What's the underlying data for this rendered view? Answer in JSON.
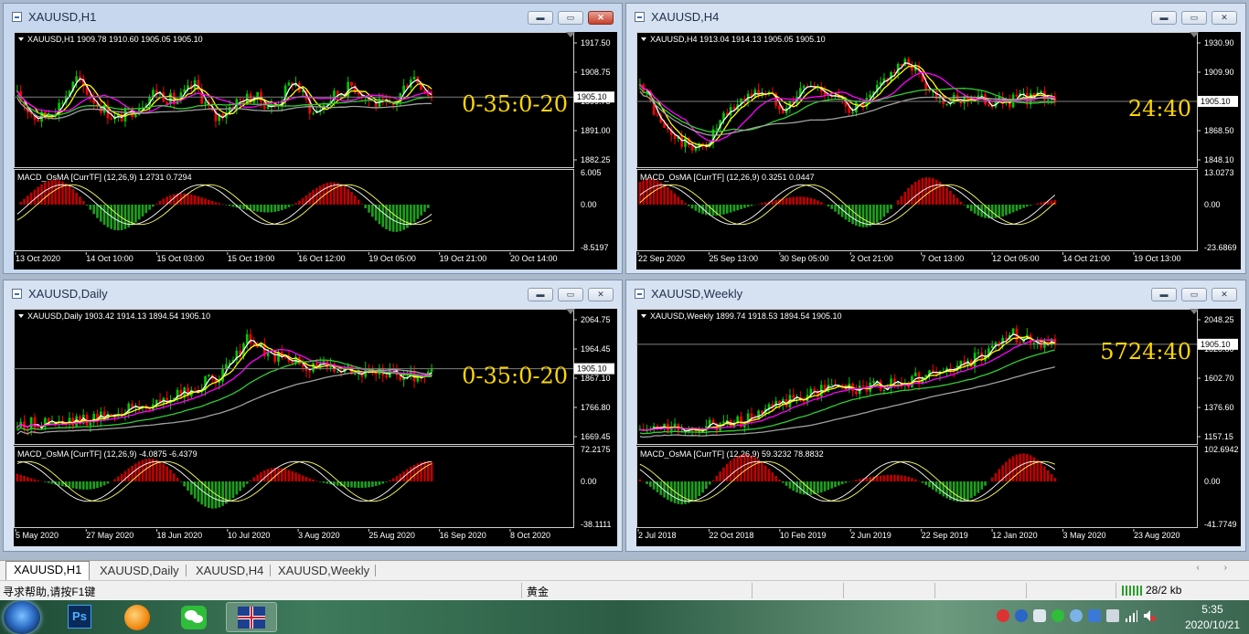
{
  "windows": [
    {
      "title": "XAUUSD,H1",
      "active": true,
      "info": "XAUUSD,H1  1909.78 1910.60 1905.05 1905.10",
      "overlay_text": "0-35:0-20",
      "price_ticks": [
        "1917.50",
        "1908.75",
        "1899.75",
        "1891.00",
        "1882.25"
      ],
      "current_price": "1905.10",
      "indicator_info": "MACD_OsMA [CurrTF] (12,26,9) 1.2731 0.7294",
      "ind_ticks": [
        "6.005",
        "0.00",
        "-8.5197"
      ],
      "dates": [
        "13 Oct 2020",
        "14 Oct 10:00",
        "15 Oct 03:00",
        "15 Oct 19:00",
        "16 Oct 12:00",
        "19 Oct 05:00",
        "19 Oct 21:00",
        "20 Oct 14:00"
      ]
    },
    {
      "title": "XAUUSD,H4",
      "active": false,
      "info": "XAUUSD,H4  1913.04 1914.13 1905.05 1905.10",
      "overlay_text": "24:40",
      "price_ticks": [
        "1930.90",
        "1909.90",
        "1889.55",
        "1868.50",
        "1848.10"
      ],
      "current_price": "1905.10",
      "indicator_info": "MACD_OsMA [CurrTF] (12,26,9) 0.3251 0.0447",
      "ind_ticks": [
        "13.0273",
        "0.00",
        "-23.6869"
      ],
      "dates": [
        "22 Sep 2020",
        "25 Sep 13:00",
        "30 Sep 05:00",
        "2 Oct 21:00",
        "7 Oct 13:00",
        "12 Oct 05:00",
        "14 Oct 21:00",
        "19 Oct 13:00"
      ]
    },
    {
      "title": "XAUUSD,Daily",
      "active": false,
      "info": "XAUUSD,Daily  1903.42 1914.13 1894.54 1905.10",
      "overlay_text": "0-35:0-20",
      "price_ticks": [
        "2064.75",
        "1964.45",
        "1867.10",
        "1766.80",
        "1669.45"
      ],
      "current_price": "1905.10",
      "indicator_info": "MACD_OsMA [CurrTF] (12,26,9) -4.0875 -6.4379",
      "ind_ticks": [
        "72.2175",
        "0.00",
        "-38.1111"
      ],
      "dates": [
        "5 May 2020",
        "27 May 2020",
        "18 Jun 2020",
        "10 Jul 2020",
        "3 Aug 2020",
        "25 Aug 2020",
        "16 Sep 2020",
        "8 Oct 2020"
      ]
    },
    {
      "title": "XAUUSD,Weekly",
      "active": false,
      "info": "XAUUSD,Weekly  1899.74 1918.53 1894.54 1905.10",
      "overlay_text": "5724:40",
      "price_ticks": [
        "2048.25",
        "1828.80",
        "1602.70",
        "1376.60",
        "1157.15"
      ],
      "current_price": "1905.10",
      "indicator_info": "MACD_OsMA [CurrTF] (12,26,9) 59.3232 78.8832",
      "ind_ticks": [
        "102.6942",
        "0.00",
        "-41.7749"
      ],
      "dates": [
        "2 Jul 2018",
        "22 Oct 2018",
        "10 Feb 2019",
        "2 Jun 2019",
        "22 Sep 2019",
        "12 Jan 2020",
        "3 May 2020",
        "23 Aug 2020"
      ]
    }
  ],
  "window_buttons": {
    "minimize": "▬",
    "maximize": "▭",
    "close": "✕"
  },
  "tabs": [
    "XAUUSD,H1",
    "XAUUSD,Daily",
    "XAUUSD,H4",
    "XAUUSD,Weekly"
  ],
  "tab_arrows": "‹ ›",
  "status": {
    "help": "寻求帮助,请按F1键",
    "profile": "黄金",
    "traffic": "28/2 kb"
  },
  "taskbar": {
    "apps": [
      "windows-start",
      "photoshop",
      "browser",
      "wechat",
      "terminal-flag"
    ],
    "time": "5:35",
    "date": "2020/10/21"
  },
  "colors": {
    "candle_up": "#00c800",
    "candle_down": "#ff0000",
    "ma_fast": "#ffffff",
    "ma_yellow": "#ffff00",
    "ma_magenta": "#ff00ff",
    "ma_green": "#32cd32",
    "ma_gray": "#a0a0a0",
    "overlay": "#ffd700",
    "macd_pos": "#c00000",
    "macd_neg": "#1e9e1e"
  }
}
